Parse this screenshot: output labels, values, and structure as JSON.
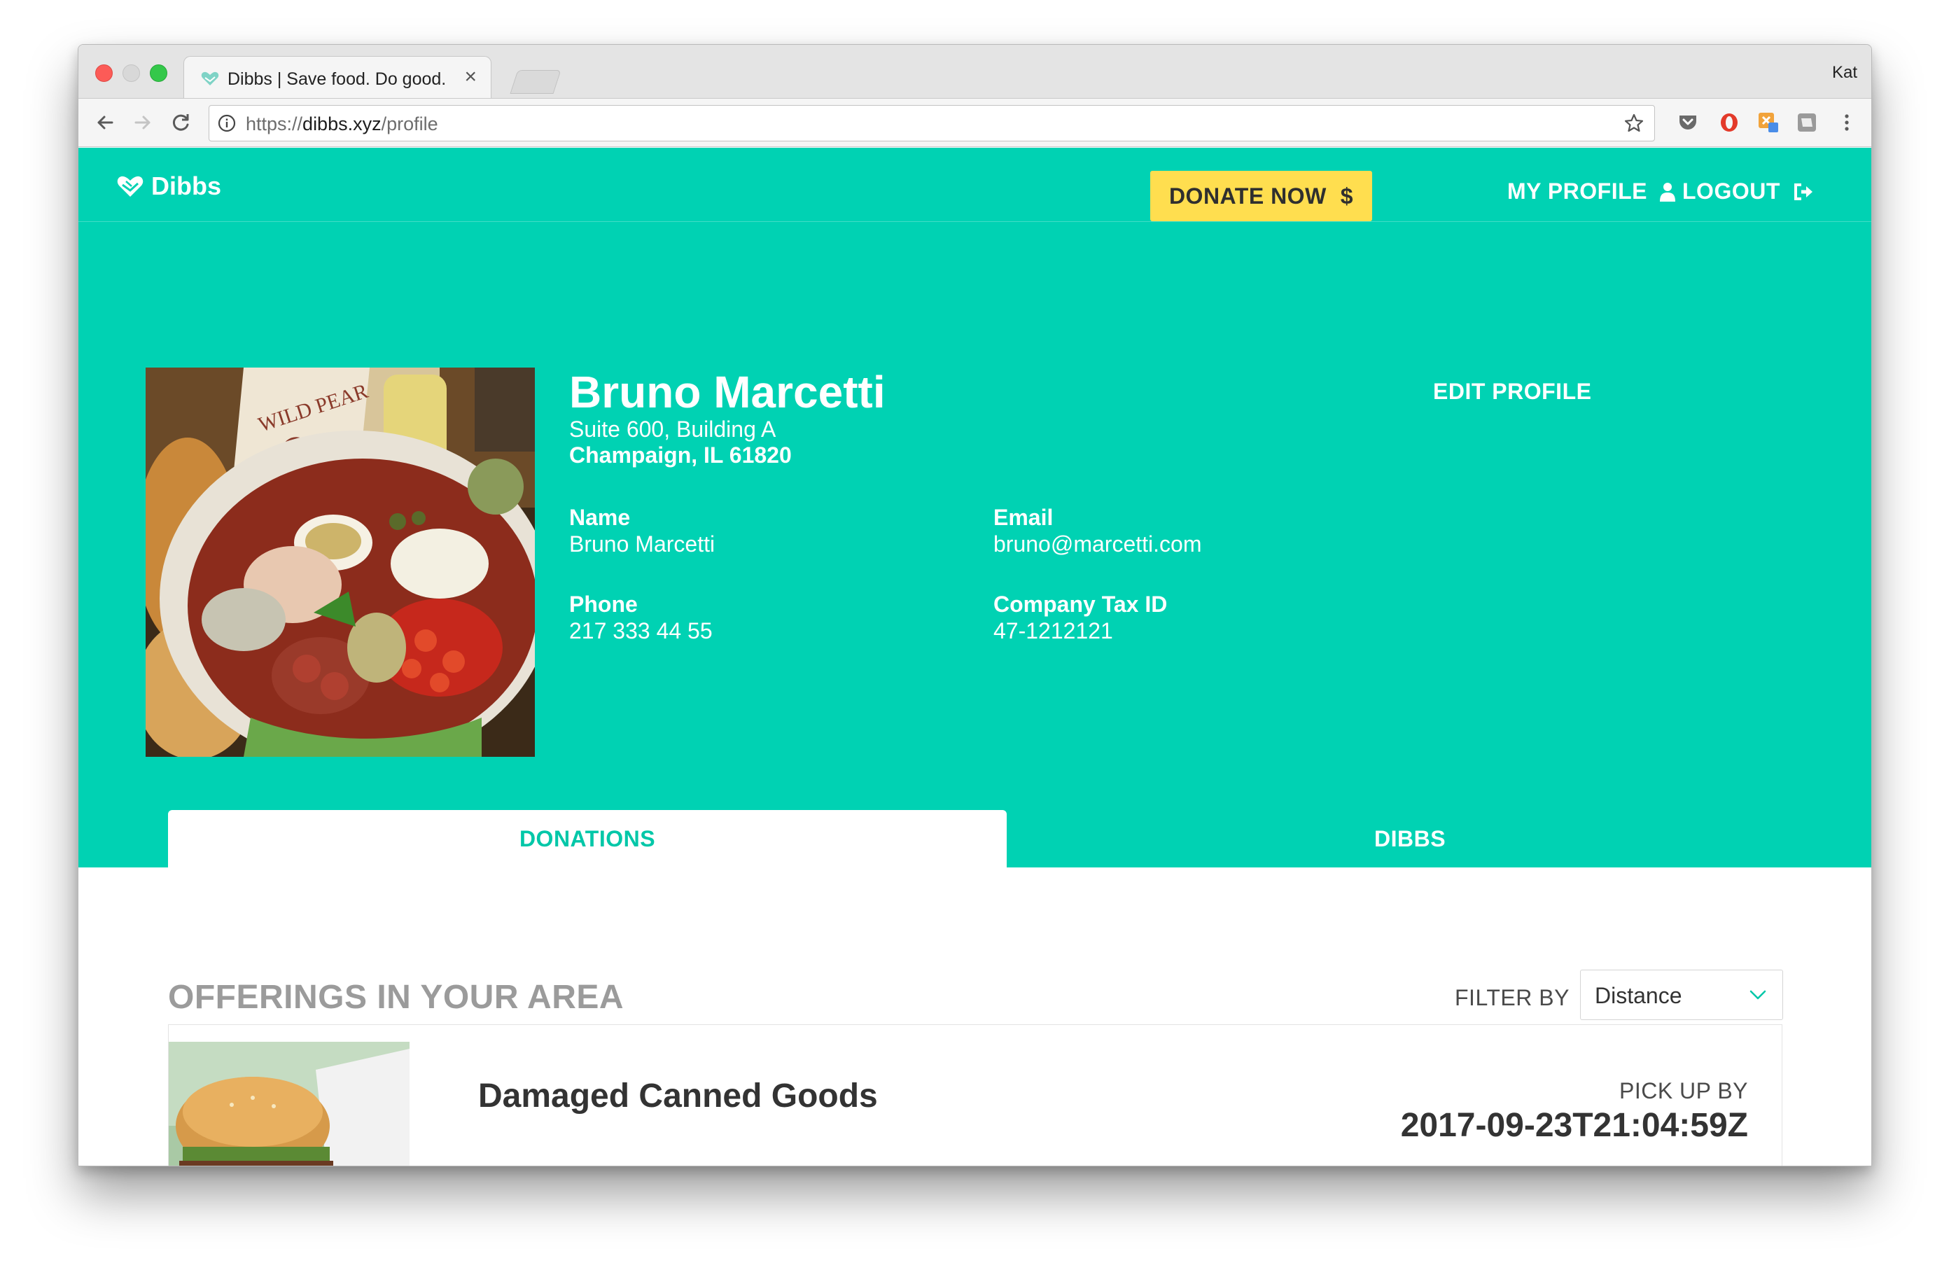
{
  "browser": {
    "tab_title": "Dibbs | Save food. Do good.",
    "tab_close": "×",
    "profile_name": "Kat",
    "url_scheme": "https://",
    "url_host": "dibbs.xyz",
    "url_path": "/profile"
  },
  "nav": {
    "brand": "Dibbs",
    "donate_label": "DONATE NOW",
    "donate_icon": "$",
    "my_profile_label": "MY PROFILE",
    "logout_label": "LOGOUT"
  },
  "profile": {
    "name": "Bruno Marcetti",
    "address_line1": "Suite 600, Building A",
    "address_line2": "Champaign, IL 61820",
    "edit_label": "EDIT PROFILE",
    "fields": {
      "name_label": "Name",
      "name_value": "Bruno Marcetti",
      "email_label": "Email",
      "email_value": "bruno@marcetti.com",
      "phone_label": "Phone",
      "phone_value": "217 333 44 55",
      "tax_label": "Company Tax ID",
      "tax_value": "47-1212121"
    },
    "photo_sign_text": "WILD PEAR"
  },
  "tabs": [
    {
      "label": "DONATIONS",
      "active": true
    },
    {
      "label": "DIBBS",
      "active": false
    }
  ],
  "offerings": {
    "title": "OFFERINGS IN YOUR AREA",
    "filter_label": "FILTER BY",
    "filter_value": "Distance",
    "items": [
      {
        "title": "Damaged Canned Goods",
        "pickup_label": "PICK UP BY",
        "pickup_date": "2017-09-23T21:04:59Z"
      }
    ]
  },
  "colors": {
    "brand_teal": "#00d2b3",
    "donate_yellow": "#ffde4f",
    "active_tab_text": "#00c7a8"
  },
  "icons": {
    "brand": "heart-hands-icon",
    "my_profile": "user-icon",
    "logout": "sign-out-icon",
    "filter": "chevron-down-icon"
  }
}
